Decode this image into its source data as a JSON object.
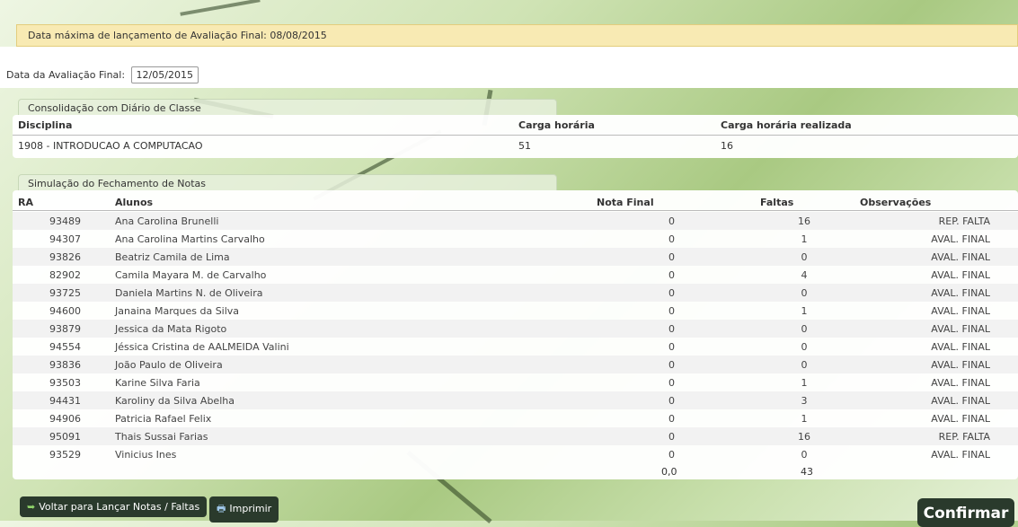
{
  "notice": "Data máxima de lançamento de Avaliação Final: 08/08/2015",
  "final_date": {
    "label": "Data da Avaliação Final:",
    "value": "12/05/2015"
  },
  "consolidation": {
    "tab_label": "Consolidação com Diário de Classe",
    "headers": {
      "discipline": "Disciplina",
      "hours": "Carga horária",
      "hours_done": "Carga horária realizada"
    },
    "row": {
      "discipline": "1908 - INTRODUCAO A COMPUTACAO",
      "hours": "51",
      "hours_done": "16"
    }
  },
  "simulation": {
    "tab_label": "Simulação do Fechamento de Notas",
    "headers": {
      "ra": "RA",
      "students": "Alunos",
      "final_grade": "Nota Final",
      "absences": "Faltas",
      "observations": "Observações"
    },
    "rows": [
      {
        "ra": "93489",
        "name": "Ana Carolina Brunelli",
        "grade": "0",
        "absences": "16",
        "obs": "REP. FALTA"
      },
      {
        "ra": "94307",
        "name": "Ana Carolina Martins Carvalho",
        "grade": "0",
        "absences": "1",
        "obs": "AVAL. FINAL"
      },
      {
        "ra": "93826",
        "name": "Beatriz Camila de Lima",
        "grade": "0",
        "absences": "0",
        "obs": "AVAL. FINAL"
      },
      {
        "ra": "82902",
        "name": "Camila Mayara M. de Carvalho",
        "grade": "0",
        "absences": "4",
        "obs": "AVAL. FINAL"
      },
      {
        "ra": "93725",
        "name": "Daniela Martins N. de Oliveira",
        "grade": "0",
        "absences": "0",
        "obs": "AVAL. FINAL"
      },
      {
        "ra": "94600",
        "name": "Janaina Marques da Silva",
        "grade": "0",
        "absences": "1",
        "obs": "AVAL. FINAL"
      },
      {
        "ra": "93879",
        "name": "Jessica da Mata Rigoto",
        "grade": "0",
        "absences": "0",
        "obs": "AVAL. FINAL"
      },
      {
        "ra": "94554",
        "name": "Jéssica Cristina de AALMEIDA Valini",
        "grade": "0",
        "absences": "0",
        "obs": "AVAL. FINAL"
      },
      {
        "ra": "93836",
        "name": "João Paulo de Oliveira",
        "grade": "0",
        "absences": "0",
        "obs": "AVAL. FINAL"
      },
      {
        "ra": "93503",
        "name": "Karine Silva Faria",
        "grade": "0",
        "absences": "1",
        "obs": "AVAL. FINAL"
      },
      {
        "ra": "94431",
        "name": "Karoliny da Silva Abelha",
        "grade": "0",
        "absences": "3",
        "obs": "AVAL. FINAL"
      },
      {
        "ra": "94906",
        "name": "Patricia Rafael Felix",
        "grade": "0",
        "absences": "1",
        "obs": "AVAL. FINAL"
      },
      {
        "ra": "95091",
        "name": "Thais Sussai Farias",
        "grade": "0",
        "absences": "16",
        "obs": "REP. FALTA"
      },
      {
        "ra": "93529",
        "name": "Vinicius Ines",
        "grade": "0",
        "absences": "0",
        "obs": "AVAL. FINAL"
      }
    ],
    "totals": {
      "grade": "0,0",
      "absences": "43"
    }
  },
  "buttons": {
    "back": {
      "label": "Voltar para Lançar Notas / Faltas",
      "icon": "back-arrow-icon"
    },
    "print": {
      "label": "Imprimir",
      "icon": "printer-icon"
    },
    "confirm": {
      "label": "Confirmar"
    }
  }
}
